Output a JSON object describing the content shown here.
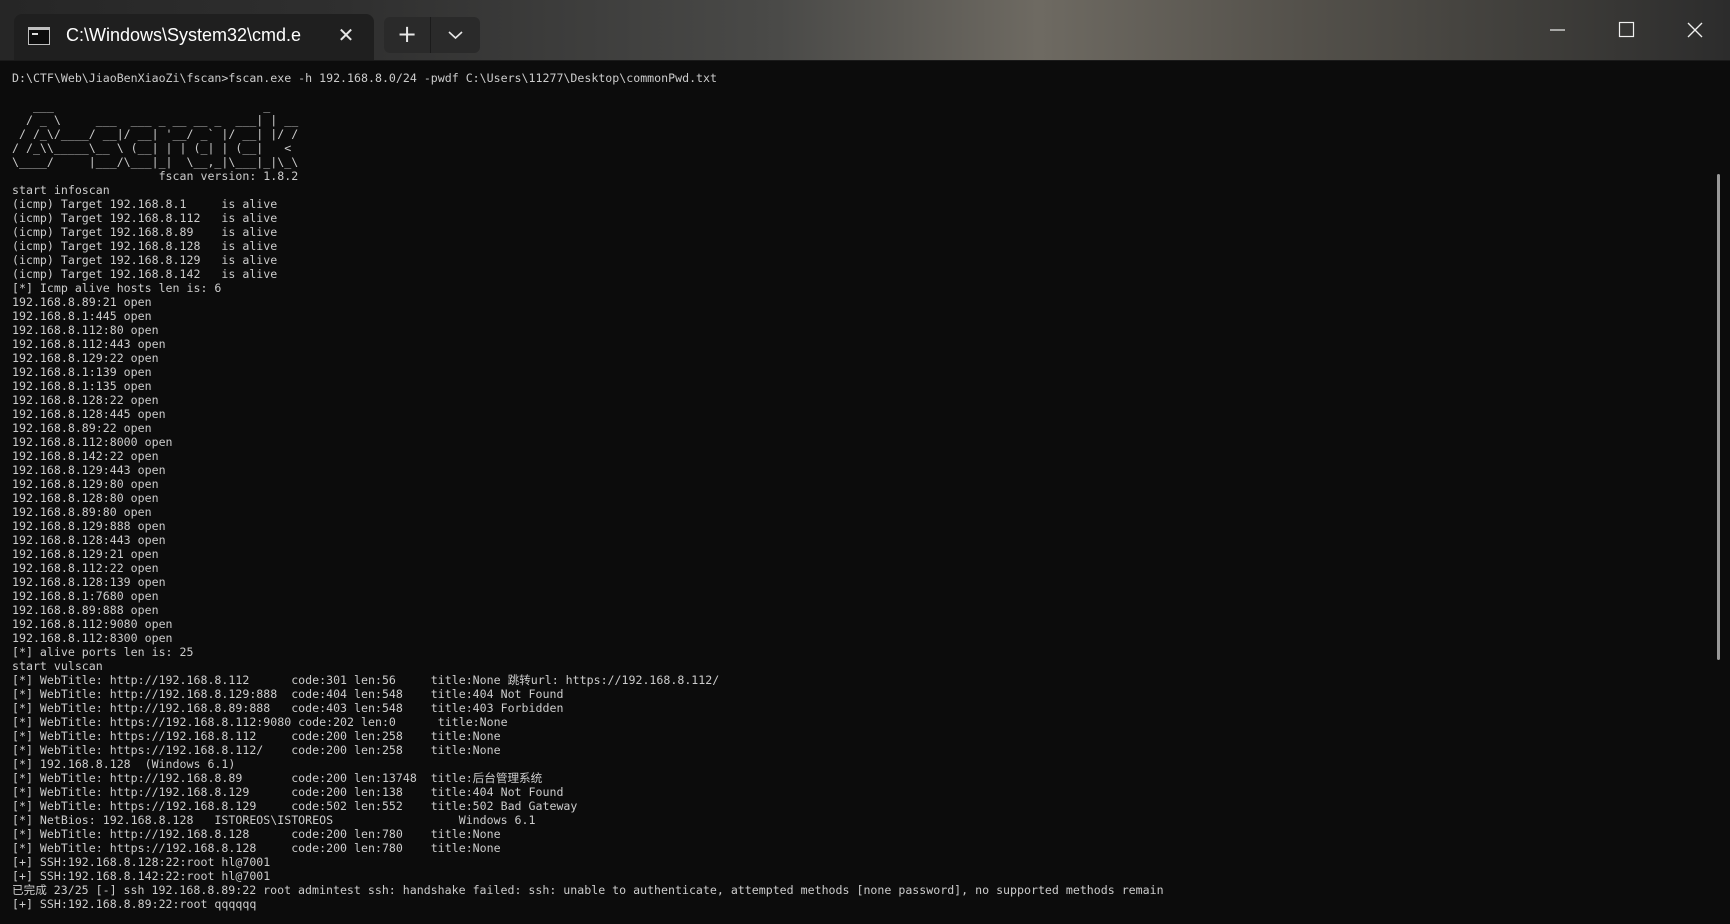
{
  "window": {
    "tab_title": "C:\\Windows\\System32\\cmd.e",
    "tab_close_glyph": "✕",
    "new_tab_glyph": "+",
    "icons": {
      "tab_icon": "terminal-icon",
      "close_tab": "close-icon",
      "new_tab": "plus-icon",
      "dropdown": "chevron-down-icon",
      "minimize": "minimize-icon",
      "maximize": "maximize-icon",
      "close_window": "close-icon"
    }
  },
  "terminal": {
    "command": "D:\\CTF\\Web\\JiaoBenXiaoZi\\fscan>fscan.exe -h 192.168.8.0/24 -pwdf C:\\Users\\11277\\Desktop\\commonPwd.txt",
    "banner": [
      "   ___                              _",
      "  / _ \\     ___  ___ _ __ __ _  ___| | __",
      " / /_\\/____/ __|/ __| '__/ _` |/ __| |/ /",
      "/ /_\\\\_____\\__ \\ (__| | | (_| | (__|   <",
      "\\____/     |___/\\___|_|  \\__,_|\\___|_|\\_\\",
      "                     fscan version: 1.8.2"
    ],
    "output": [
      "start infoscan",
      "(icmp) Target 192.168.8.1     is alive",
      "(icmp) Target 192.168.8.112   is alive",
      "(icmp) Target 192.168.8.89    is alive",
      "(icmp) Target 192.168.8.128   is alive",
      "(icmp) Target 192.168.8.129   is alive",
      "(icmp) Target 192.168.8.142   is alive",
      "[*] Icmp alive hosts len is: 6",
      "192.168.8.89:21 open",
      "192.168.8.1:445 open",
      "192.168.8.112:80 open",
      "192.168.8.112:443 open",
      "192.168.8.129:22 open",
      "192.168.8.1:139 open",
      "192.168.8.1:135 open",
      "192.168.8.128:22 open",
      "192.168.8.128:445 open",
      "192.168.8.89:22 open",
      "192.168.8.112:8000 open",
      "192.168.8.142:22 open",
      "192.168.8.129:443 open",
      "192.168.8.129:80 open",
      "192.168.8.128:80 open",
      "192.168.8.89:80 open",
      "192.168.8.129:888 open",
      "192.168.8.128:443 open",
      "192.168.8.129:21 open",
      "192.168.8.112:22 open",
      "192.168.8.128:139 open",
      "192.168.8.1:7680 open",
      "192.168.8.89:888 open",
      "192.168.8.112:9080 open",
      "192.168.8.112:8300 open",
      "[*] alive ports len is: 25",
      "start vulscan",
      "[*] WebTitle: http://192.168.8.112      code:301 len:56     title:None 跳转url: https://192.168.8.112/",
      "[*] WebTitle: http://192.168.8.129:888  code:404 len:548    title:404 Not Found",
      "[*] WebTitle: http://192.168.8.89:888   code:403 len:548    title:403 Forbidden",
      "[*] WebTitle: https://192.168.8.112:9080 code:202 len:0      title:None",
      "[*] WebTitle: https://192.168.8.112     code:200 len:258    title:None",
      "[*] WebTitle: https://192.168.8.112/    code:200 len:258    title:None",
      "[*] 192.168.8.128  (Windows 6.1)",
      "[*] WebTitle: http://192.168.8.89       code:200 len:13748  title:后台管理系统",
      "[*] WebTitle: http://192.168.8.129      code:200 len:138    title:404 Not Found",
      "[*] WebTitle: https://192.168.8.129     code:502 len:552    title:502 Bad Gateway",
      "[*] NetBios: 192.168.8.128   ISTOREOS\\ISTOREOS                  Windows 6.1",
      "[*] WebTitle: http://192.168.8.128      code:200 len:780    title:None",
      "[*] WebTitle: https://192.168.8.128     code:200 len:780    title:None",
      "[+] SSH:192.168.8.128:22:root hl@7001",
      "[+] SSH:192.168.8.142:22:root hl@7001",
      "已完成 23/25 [-] ssh 192.168.8.89:22 root admintest ssh: handshake failed: ssh: unable to authenticate, attempted methods [none password], no supported methods remain",
      "[+] SSH:192.168.8.89:22:root qqqqqq"
    ]
  }
}
